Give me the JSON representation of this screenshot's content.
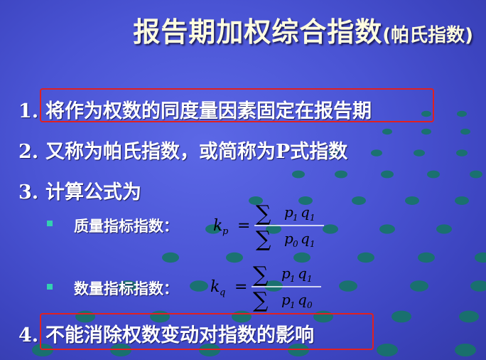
{
  "title": {
    "main": "报告期加权综合指数",
    "sub": "(帕氏指数)"
  },
  "items": [
    {
      "num": "1.",
      "text": "将作为权数的同度量因素固定在报告期"
    },
    {
      "num": "2.",
      "text": "又称为帕氏指数，或简称为P式指数"
    },
    {
      "num": "3.",
      "text": "计算公式为"
    },
    {
      "num": "4.",
      "text": "不能消除权数变动对指数的影响"
    }
  ],
  "subitems": [
    {
      "label": "质量指标指数：",
      "formula": {
        "lhs": "k",
        "lhs_sub": "p",
        "num_a": "p",
        "num_a_sub": "1",
        "num_b": "q",
        "num_b_sub": "1",
        "den_a": "p",
        "den_a_sub": "0",
        "den_b": "q",
        "den_b_sub": "1"
      }
    },
    {
      "label": "数量指标指数：",
      "formula": {
        "lhs": "k",
        "lhs_sub": "q",
        "num_a": "p",
        "num_a_sub": "1",
        "num_b": "q",
        "num_b_sub": "1",
        "den_a": "p",
        "den_a_sub": "1",
        "den_b": "q",
        "den_b_sub": "0"
      }
    }
  ],
  "colors": {
    "background": "#4a54d4",
    "title": "#fffde0",
    "text": "#ffffff",
    "highlight_box": "#e02020",
    "bullet": "#33d0b0",
    "dots": "#1a7a6a"
  }
}
